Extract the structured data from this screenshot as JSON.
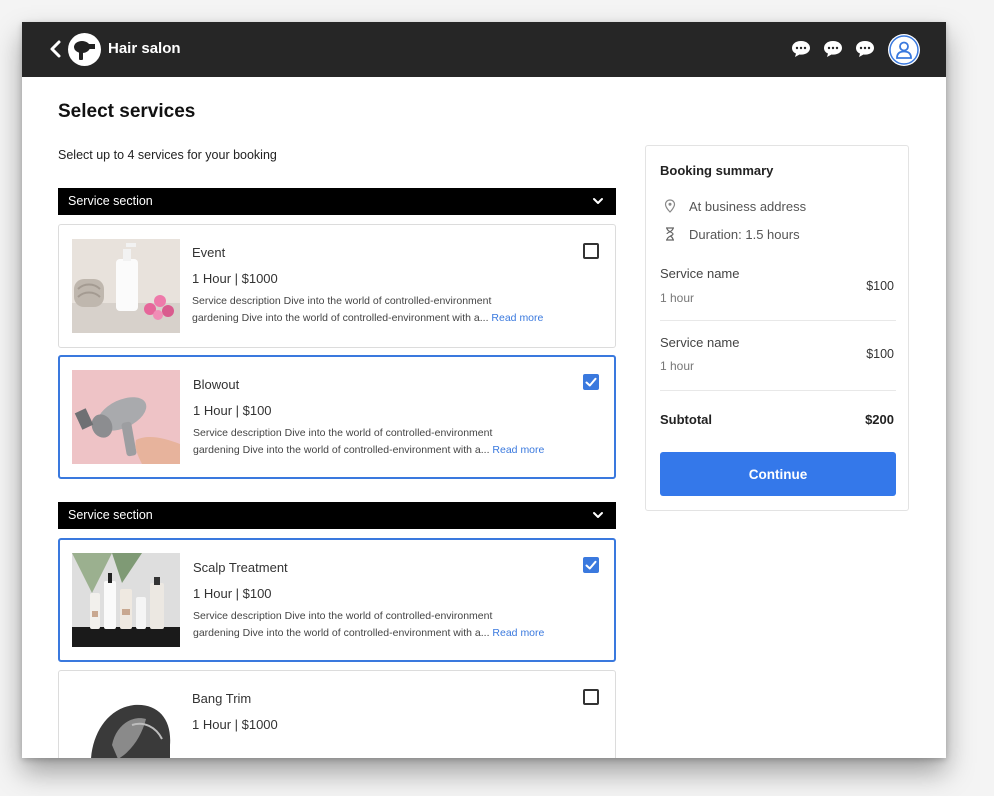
{
  "header": {
    "brand": "Hair salon",
    "icons": [
      "back-icon",
      "hair-dryer-logo",
      "chat-icon",
      "chat-icon",
      "chat-icon",
      "user-icon"
    ]
  },
  "page": {
    "title": "Select services",
    "subtitle": "Select up to 4 services for your booking"
  },
  "sections": [
    {
      "label": "Service section",
      "services": [
        {
          "name": "Event",
          "meta": "1 Hour  |  $1000",
          "desc_line1": "Service description Dive into the world of controlled-environment",
          "desc_line2": "gardening Dive into the world of controlled-environment with a...",
          "read_more": "Read more",
          "checked": false
        },
        {
          "name": "Blowout",
          "meta": "1 Hour  |  $100",
          "desc_line1": "Service description Dive into the world of controlled-environment",
          "desc_line2": "gardening Dive into the world of controlled-environment with a...",
          "read_more": "Read more",
          "checked": true
        }
      ]
    },
    {
      "label": "Service section",
      "services": [
        {
          "name": "Scalp Treatment",
          "meta": "1 Hour  |  $100",
          "desc_line1": "Service description Dive into the world of controlled-environment",
          "desc_line2": "gardening Dive into the world of controlled-environment with a...",
          "read_more": "Read more",
          "checked": true
        },
        {
          "name": "Bang Trim",
          "meta": "1 Hour  |  $1000",
          "checked": false
        }
      ]
    }
  ],
  "summary": {
    "title": "Booking summary",
    "location": "At business address",
    "duration": "Duration: 1.5 hours",
    "items": [
      {
        "name": "Service name",
        "duration": "1 hour",
        "price": "$100"
      },
      {
        "name": "Service name",
        "duration": "1 hour",
        "price": "$100"
      }
    ],
    "subtotal_label": "Subtotal",
    "subtotal_value": "$200",
    "continue_label": "Continue"
  },
  "colors": {
    "accent": "#3478ea",
    "topbar": "#262626",
    "section_bar": "#000000"
  }
}
